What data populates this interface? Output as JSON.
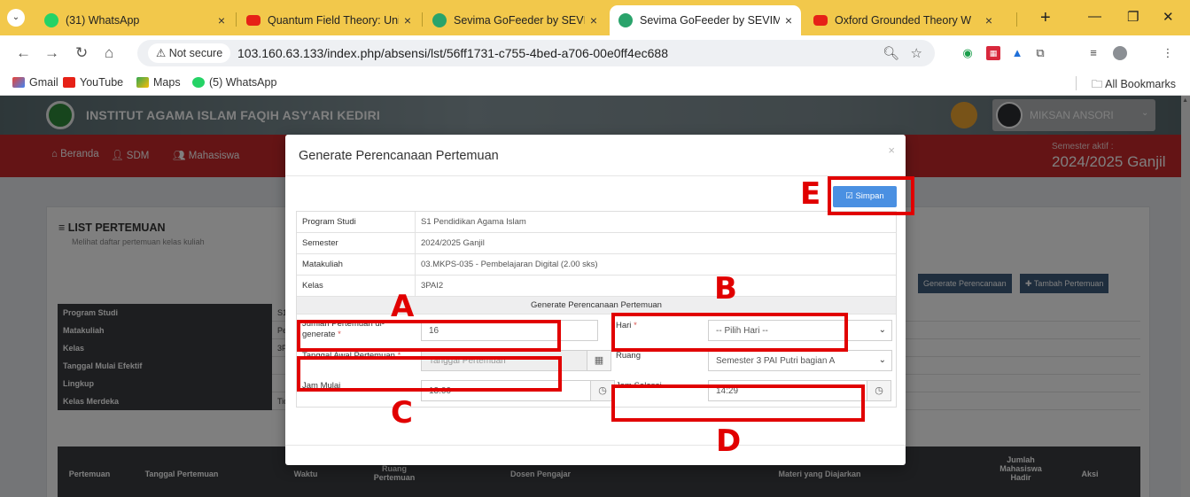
{
  "browser": {
    "tabs": [
      {
        "title": "(31) WhatsApp",
        "favicon": "whatsapp-icon"
      },
      {
        "title": "Quantum Field Theory: Unive",
        "favicon": "youtube-icon"
      },
      {
        "title": "Sevima GoFeeder by SEVIMA",
        "favicon": "sevima-icon"
      },
      {
        "title": "Sevima GoFeeder by SEVIMA",
        "favicon": "sevima-icon"
      },
      {
        "title": "Oxford Grounded Theory W",
        "favicon": "youtube-icon"
      }
    ],
    "active_tab_index": 3,
    "not_secure_label": "Not secure",
    "url": "103.160.63.133/index.php/absensi/lst/56ff1731-c755-4bed-a706-00e0ff4ec688",
    "bookmarks": [
      {
        "label": "Gmail"
      },
      {
        "label": "YouTube"
      },
      {
        "label": "Maps"
      },
      {
        "label": "(5) WhatsApp"
      }
    ],
    "all_bookmarks_label": "All Bookmarks"
  },
  "site": {
    "institution": "INSTITUT AGAMA ISLAM FAQIH ASY'ARI KEDIRI",
    "user_name": "MIKSAN ANSORI",
    "nav": [
      "Beranda",
      "SDM",
      "Mahasiswa"
    ],
    "semester_label": "Semester aktif :",
    "semester_value": "2024/2025 Ganjil",
    "card_title": "LIST PERTEMUAN",
    "card_subtitle": "Melihat daftar pertemuan kelas kuliah",
    "btn_generate": "Generate Perencanaan",
    "btn_add": "Tambah Pertemuan",
    "info_labels": [
      "Program Studi",
      "Matakuliah",
      "Kelas",
      "Tanggal Mulai Efektif",
      "Lingkup",
      "Kelas Merdeka"
    ],
    "info_values": [
      "S1",
      "Pe",
      "3P",
      "",
      "",
      "Tid"
    ],
    "list_headers": [
      "Pertemuan",
      "Tanggal Pertemuan",
      "Waktu",
      "Ruang Pertemuan",
      "Dosen Pengajar",
      "Materi yang Diajarkan",
      "Jumlah Mahasiswa Hadir",
      "Aksi"
    ]
  },
  "modal": {
    "title": "Generate Perencanaan Pertemuan",
    "close": "×",
    "save_label": "Simpan",
    "info": [
      {
        "label": "Program Studi",
        "value": "S1 Pendidikan Agama Islam"
      },
      {
        "label": "Semester",
        "value": "2024/2025 Ganjil"
      },
      {
        "label": "Matakuliah",
        "value": "03.MKPS-035 - Pembelajaran Digital (2.00 sks)"
      },
      {
        "label": "Kelas",
        "value": "3PAI2"
      }
    ],
    "section_title": "Generate Perencanaan Pertemuan",
    "form": {
      "jumlah_label": "Jumlah Pertemuan di-generate",
      "jumlah_value": "16",
      "hari_label": "Hari",
      "hari_placeholder": "-- Pilih Hari --",
      "tanggal_label": "Tanggal Awal Pertemuan",
      "tanggal_placeholder": "Tanggal Pertemuan",
      "ruang_label": "Ruang",
      "ruang_value": "Semester 3 PAI Putri bagian A",
      "jam_mulai_label": "Jam Mulai",
      "jam_mulai_value": "13:00",
      "jam_selesai_label": "Jam Selesai",
      "jam_selesai_value": "14:29"
    }
  },
  "annotations": {
    "a": "A",
    "b": "B",
    "c": "C",
    "d": "D",
    "e": "E"
  },
  "colors": {
    "annotation": "#e10000",
    "save_button": "#4a90e2",
    "navbar": "#c9282b",
    "tabstrip": "#f2c84b"
  }
}
